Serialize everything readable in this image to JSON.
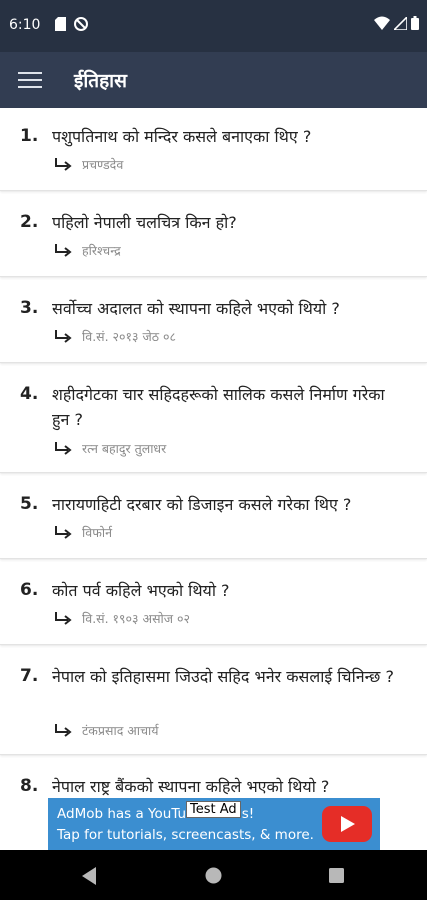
{
  "status": {
    "time": "6:10"
  },
  "appbar": {
    "title": "ईतिहास",
    "menu_icon": "hamburger-menu-icon"
  },
  "questions": [
    {
      "num": "1.",
      "question": "पशुपतिनाथ को मन्दिर कसले बनाएका थिए ?",
      "answer": "प्रचण्डदेव"
    },
    {
      "num": "2.",
      "question": "पहिलो नेपाली चलचित्र किन हो?",
      "answer": "हरिश्चन्द्र"
    },
    {
      "num": "3.",
      "question": "सर्वोच्च अदालत को स्थापना कहिले भएको थियो ?",
      "answer": "वि.सं. २०१३ जेठ ०८"
    },
    {
      "num": "4.",
      "question": "शहीदगेटका चार सहिदहरूको सालिक कसले निर्माण गरेका हुन ?",
      "answer": "रत्न बहादुर तुलाधर"
    },
    {
      "num": "5.",
      "question": "नारायणहिटी दरबार को  डिजाइन कसले गरेका थिए ?",
      "answer": "विफोर्न"
    },
    {
      "num": "6.",
      "question": "कोत पर्व कहिले भएको थियो ?",
      "answer": "वि.सं. १९०३ असोज ०२"
    },
    {
      "num": "7.",
      "question": "नेपाल को इतिहासमा जिउदो सहिद भनेर कसलाई चिनिन्छ ?",
      "answer": "टंकप्रसाद आचार्य"
    },
    {
      "num": "8.",
      "question": "नेपाल राष्ट्र बैंकको स्थापना कहिले  भएको थियो ?",
      "answer": ""
    }
  ],
  "ad": {
    "badge": "Test Ad",
    "line1": "AdMob has a YouTube Series!",
    "line2": "Tap for tutorials, screencasts, & more."
  },
  "colors": {
    "statusbar": "#273142",
    "appbar": "#323d52",
    "ad_background": "#3b8ed0",
    "youtube_red": "#e52d27"
  }
}
